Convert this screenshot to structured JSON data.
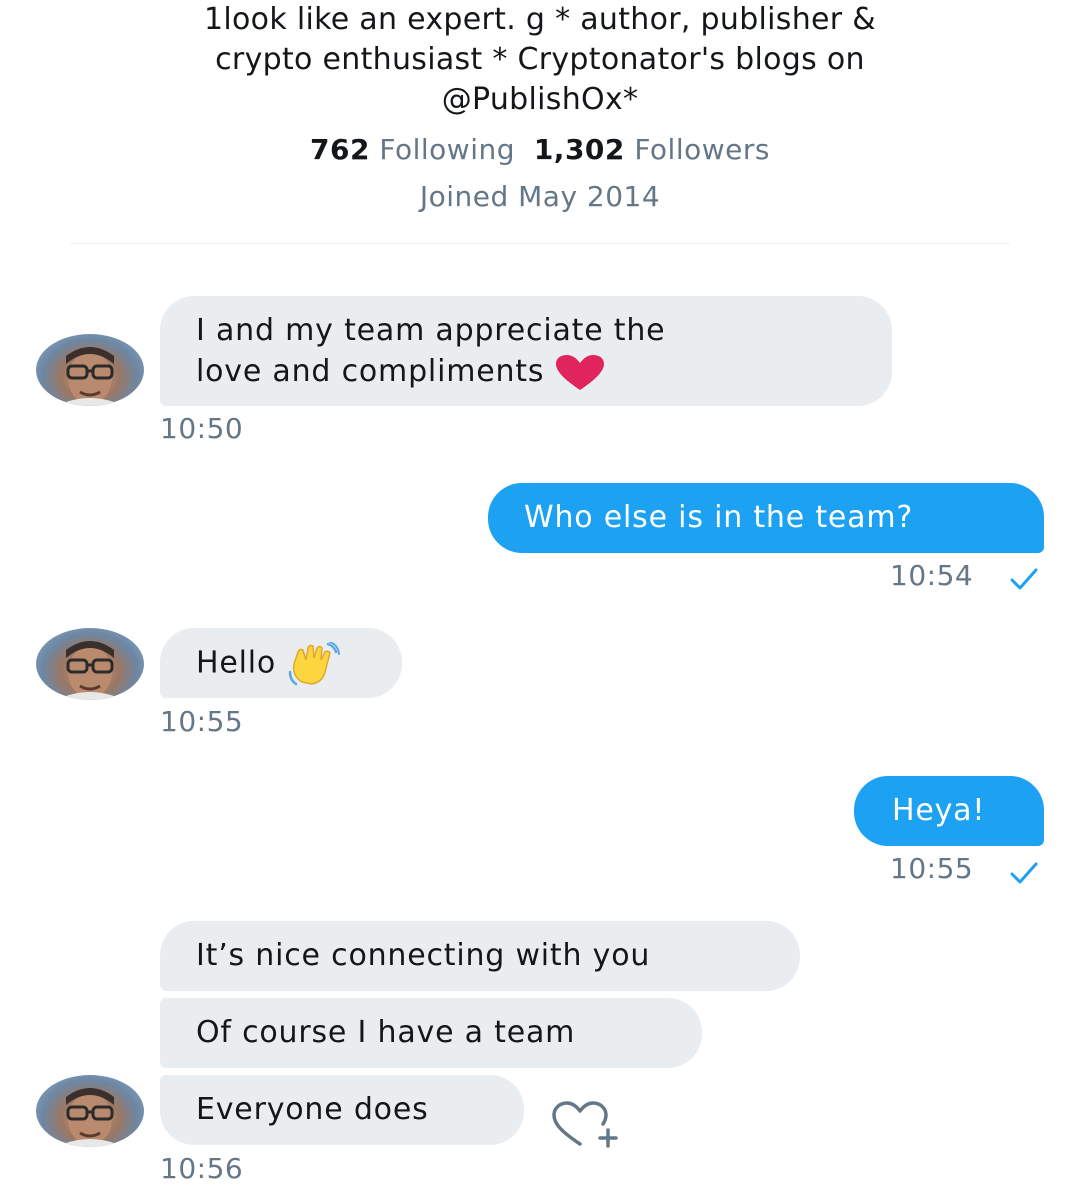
{
  "profile": {
    "bio_line1": "1look like an expert. g * author, publisher &",
    "bio_line2": "crypto enthusiast * Cryptonator's blogs on",
    "bio_line3": "@PublishOx*",
    "following_count": "762",
    "following_label": "Following",
    "followers_count": "1,302",
    "followers_label": "Followers",
    "joined": "Joined May 2014"
  },
  "messages": [
    {
      "direction": "received",
      "line1": "I and my team appreciate the",
      "line2": "love and compliments",
      "emoji": "heart-icon",
      "time": "10:50"
    },
    {
      "direction": "sent",
      "text": "Who else is in the team?",
      "time": "10:54"
    },
    {
      "direction": "received",
      "text": "Hello",
      "emoji": "waving-hand-icon",
      "time": "10:55"
    },
    {
      "direction": "sent",
      "text": "Heya!",
      "time": "10:55"
    },
    {
      "direction": "received",
      "text": "It’s nice connecting with you"
    },
    {
      "direction": "received",
      "text": "Of course I have a team"
    },
    {
      "direction": "received",
      "text": "Everyone does",
      "time": "10:56"
    }
  ],
  "colors": {
    "sent_bubble": "#1da1f2",
    "received_bubble": "#e9edf0",
    "secondary_text": "#657786",
    "heart": "#e0245e"
  }
}
